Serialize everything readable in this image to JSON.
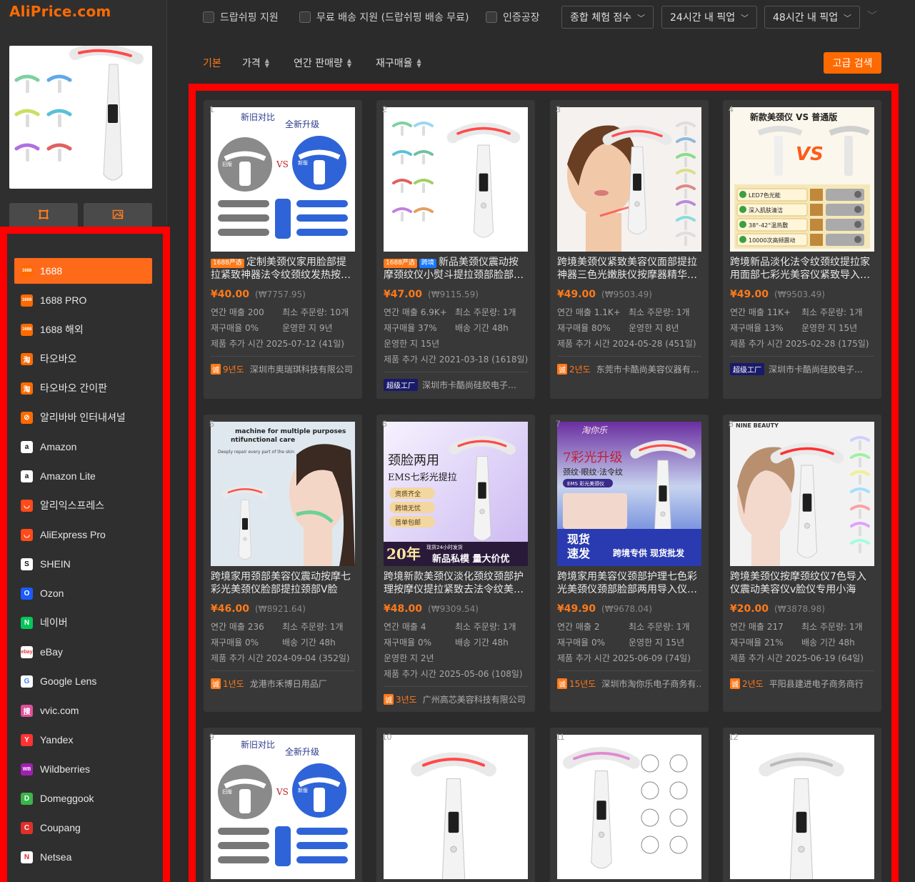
{
  "brand": {
    "logo": "AliPrice.com"
  },
  "filters": {
    "checkboxes": [
      "드랍쉬핑 지원",
      "무료 배송 지원 (드랍쉬핑 배송 무료)",
      "인증공장"
    ],
    "dropdowns": [
      "종합 체험 점수",
      "24시간 내 픽업",
      "48시간 내 픽업"
    ]
  },
  "sort": {
    "items": [
      "기본",
      "가격",
      "연간 판매량",
      "재구매율"
    ],
    "active": "기본",
    "advanced_search": "고급 검색"
  },
  "platforms": [
    {
      "label": "1688",
      "icon": "1688",
      "color": "#ff6a00",
      "active": true
    },
    {
      "label": "1688 PRO",
      "icon": "1688",
      "color": "#ff6a00"
    },
    {
      "label": "1688 해외",
      "icon": "1688",
      "color": "#ff6a00"
    },
    {
      "label": "타오바오",
      "icon": "淘",
      "color": "#ff6a00"
    },
    {
      "label": "타오바오 간이판",
      "icon": "淘",
      "color": "#ff6a00"
    },
    {
      "label": "알리바바 인터내셔널",
      "icon": "⊘",
      "color": "#ff6a00"
    },
    {
      "label": "Amazon",
      "icon": "a",
      "color": "#ffffff"
    },
    {
      "label": "Amazon Lite",
      "icon": "a",
      "color": "#ffffff"
    },
    {
      "label": "알리익스프레스",
      "icon": "◡",
      "color": "#ff4a1a"
    },
    {
      "label": "AliExpress Pro",
      "icon": "◡",
      "color": "#ff4a1a"
    },
    {
      "label": "SHEIN",
      "icon": "S",
      "color": "#ffffff"
    },
    {
      "label": "Ozon",
      "icon": "O",
      "color": "#1a5cff"
    },
    {
      "label": "네이버",
      "icon": "N",
      "color": "#03c75a"
    },
    {
      "label": "eBay",
      "icon": "ebay",
      "color": "#ffffff"
    },
    {
      "label": "Google Lens",
      "icon": "G",
      "color": "#ffffff"
    },
    {
      "label": "vvic.com",
      "icon": "搜",
      "color": "#e0509a"
    },
    {
      "label": "Yandex",
      "icon": "Y",
      "color": "#ff3333"
    },
    {
      "label": "Wildberries",
      "icon": "WB",
      "color": "#a020b0"
    },
    {
      "label": "Domeggook",
      "icon": "D",
      "color": "#3ab54a"
    },
    {
      "label": "Coupang",
      "icon": "C",
      "color": "#e0302a"
    },
    {
      "label": "Netsea",
      "icon": "N",
      "color": "#ffffff"
    }
  ],
  "labels": {
    "annual_sales": "연간 매출",
    "min_order": "최소 주문량:",
    "repurchase": "재구매율",
    "operating": "운영한 지",
    "shipping": "배송 기간",
    "added": "제품 추가 시간",
    "factory_badge": "超级工厂",
    "supplier_badge": "诚"
  },
  "products": [
    {
      "num": "1",
      "tags": [
        "1688严选"
      ],
      "title": "定制美颈仪家用脸部提拉紧致神器法令纹颈纹发热按…",
      "price": "¥40.00",
      "krw": "(₩7757.95)",
      "sales": "200",
      "moq": "10개",
      "repurchase": "0%",
      "years_op": "9년",
      "added": "2025-07-12 (41일)",
      "supplier_years": "9년도",
      "supplier": "深圳市奥瑞琪科技有限公司",
      "factory": false,
      "shipping": null
    },
    {
      "num": "2",
      "tags": [
        "1688严选",
        "跨境"
      ],
      "title": "新品美颈仪震动按摩颈纹仪小熨斗提拉颈部脸部…",
      "price": "¥47.00",
      "krw": "(₩9115.59)",
      "sales": "6.9K+",
      "moq": "1개",
      "repurchase": "37%",
      "years_op": "15년",
      "added": "2021-03-18 (1618일)",
      "supplier_years": "",
      "supplier": "深圳市卡酷尚硅胶电子…",
      "factory": true,
      "shipping": "48h"
    },
    {
      "num": "3",
      "tags": [],
      "title": "跨境美颈仪紧致美容仪面部提拉神器三色光嫩肤仪按摩器精华…",
      "price": "¥49.00",
      "krw": "(₩9503.49)",
      "sales": "1.1K+",
      "moq": "1개",
      "repurchase": "80%",
      "years_op": "8년",
      "added": "2024-05-28 (451일)",
      "supplier_years": "2년도",
      "supplier": "东莞市卡酷尚美容仪器有…",
      "factory": false,
      "shipping": null
    },
    {
      "num": "4",
      "tags": [],
      "title": "跨境新品淡化法令纹颈纹提拉家用面部七彩光美容仪紧致导入…",
      "price": "¥49.00",
      "krw": "(₩9503.49)",
      "sales": "11K+",
      "moq": "1개",
      "repurchase": "13%",
      "years_op": "15년",
      "added": "2025-02-28 (175일)",
      "supplier_years": "",
      "supplier": "深圳市卡酷尚硅胶电子…",
      "factory": true,
      "shipping": null
    },
    {
      "num": "5",
      "tags": [],
      "title": "跨境家用颈部美容仪震动按摩七彩光美颈仪脸部提拉颈部V脸导…",
      "price": "¥46.00",
      "krw": "(₩8921.64)",
      "sales": "236",
      "moq": "1개",
      "repurchase": "0%",
      "years_op": null,
      "added": "2024-09-04 (352일)",
      "supplier_years": "1년도",
      "supplier": "龙港市禾博日用品厂",
      "factory": false,
      "shipping": "48h"
    },
    {
      "num": "6",
      "tags": [],
      "title": "跨境新款美颈仪淡化颈纹颈部护理按摩仪提拉紧致去法令纹美…",
      "price": "¥48.00",
      "krw": "(₩9309.54)",
      "sales": "4",
      "moq": "1개",
      "repurchase": "0%",
      "years_op": "2년",
      "added": "2025-05-06 (108일)",
      "supplier_years": "3년도",
      "supplier": "广州高芯美容科技有限公司",
      "factory": false,
      "shipping": "48h"
    },
    {
      "num": "7",
      "tags": [],
      "title": "跨境家用美容仪颈部护理七色彩光美颈仪颈部脸部两用导入仪…",
      "price": "¥49.90",
      "krw": "(₩9678.04)",
      "sales": "2",
      "moq": "1개",
      "repurchase": "0%",
      "years_op": "15년",
      "added": "2025-06-09 (74일)",
      "supplier_years": "15년도",
      "supplier": "深圳市淘你乐电子商务有…",
      "factory": false,
      "shipping": null
    },
    {
      "num": "8",
      "tags": [],
      "title": "跨境美颈仪按摩颈纹仪7色导入仪震动美容仪v脸仪专用小海豚…",
      "price": "¥20.00",
      "krw": "(₩3878.98)",
      "sales": "217",
      "moq": "1개",
      "repurchase": "21%",
      "years_op": null,
      "added": "2025-06-19 (64일)",
      "supplier_years": "2년도",
      "supplier": "平阳县建进电子商务商行",
      "factory": false,
      "shipping": "48h"
    },
    {
      "num": "9"
    },
    {
      "num": "10"
    },
    {
      "num": "11"
    },
    {
      "num": "12"
    }
  ],
  "image_text": {
    "card1": {
      "title": "新旧对比",
      "sub": "全新升级",
      "vs": "VS",
      "old": "旧版",
      "new": "新版"
    },
    "card4": {
      "title": "新款美颈仪 VS 普通版",
      "rows": [
        "LED7色光能",
        "深入肌肤清洁",
        "38°-42°温热敷",
        "10000次高频震动"
      ]
    },
    "card5": {
      "line1": "machine for multiple purposes",
      "line2": "ntifunctional care",
      "line3": "Deeply repair every part of the skin"
    },
    "card6": {
      "t1": "颈脸两用",
      "t2": "EMS七彩光提拉",
      "b1": "资质齐全",
      "b2": "跨境无忧",
      "b3": "首单包邮",
      "big": "20年",
      "small": "现货24小时发货",
      "banner": "新品私模 量大价优"
    },
    "card7": {
      "brand": "淘你乐",
      "t1": "7彩光升级",
      "t2": "颈纹·眼纹·法令纹",
      "t3": "EMS 彩光美颈仪",
      "b1": "现货",
      "b2": "速发",
      "banner": "跨境专供 现货批发"
    },
    "card8": {
      "brand": "NINE BEAUTY"
    }
  }
}
